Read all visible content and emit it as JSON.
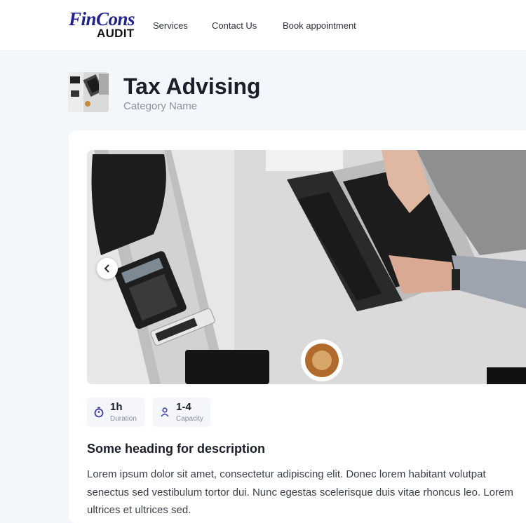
{
  "header": {
    "logo_top": "FinCons",
    "logo_bottom": "AUDIT",
    "nav": [
      {
        "label": "Services"
      },
      {
        "label": "Contact Us"
      },
      {
        "label": "Book appointment"
      }
    ]
  },
  "service": {
    "title": "Tax Advising",
    "category": "Category Name"
  },
  "stats": {
    "duration": {
      "value": "1h",
      "label": "Duration",
      "icon": "stopwatch-icon"
    },
    "capacity": {
      "value": "1-4",
      "label": "Capacity",
      "icon": "person-icon"
    }
  },
  "description": {
    "heading": "Some heading for description",
    "lines": [
      "Lorem ipsum dolor sit amet, consectetur adipiscing elit. Donec lorem habitant volutpat",
      "senectus sed vestibulum tortor dui. Nunc egestas scelerisque duis vitae rhoncus leo. Lorem",
      "ultrices et ultrices sed."
    ]
  },
  "colors": {
    "brand_navy": "#23238f",
    "page_bg": "#f3f7fc",
    "icon_accent": "#3b3fa6"
  }
}
